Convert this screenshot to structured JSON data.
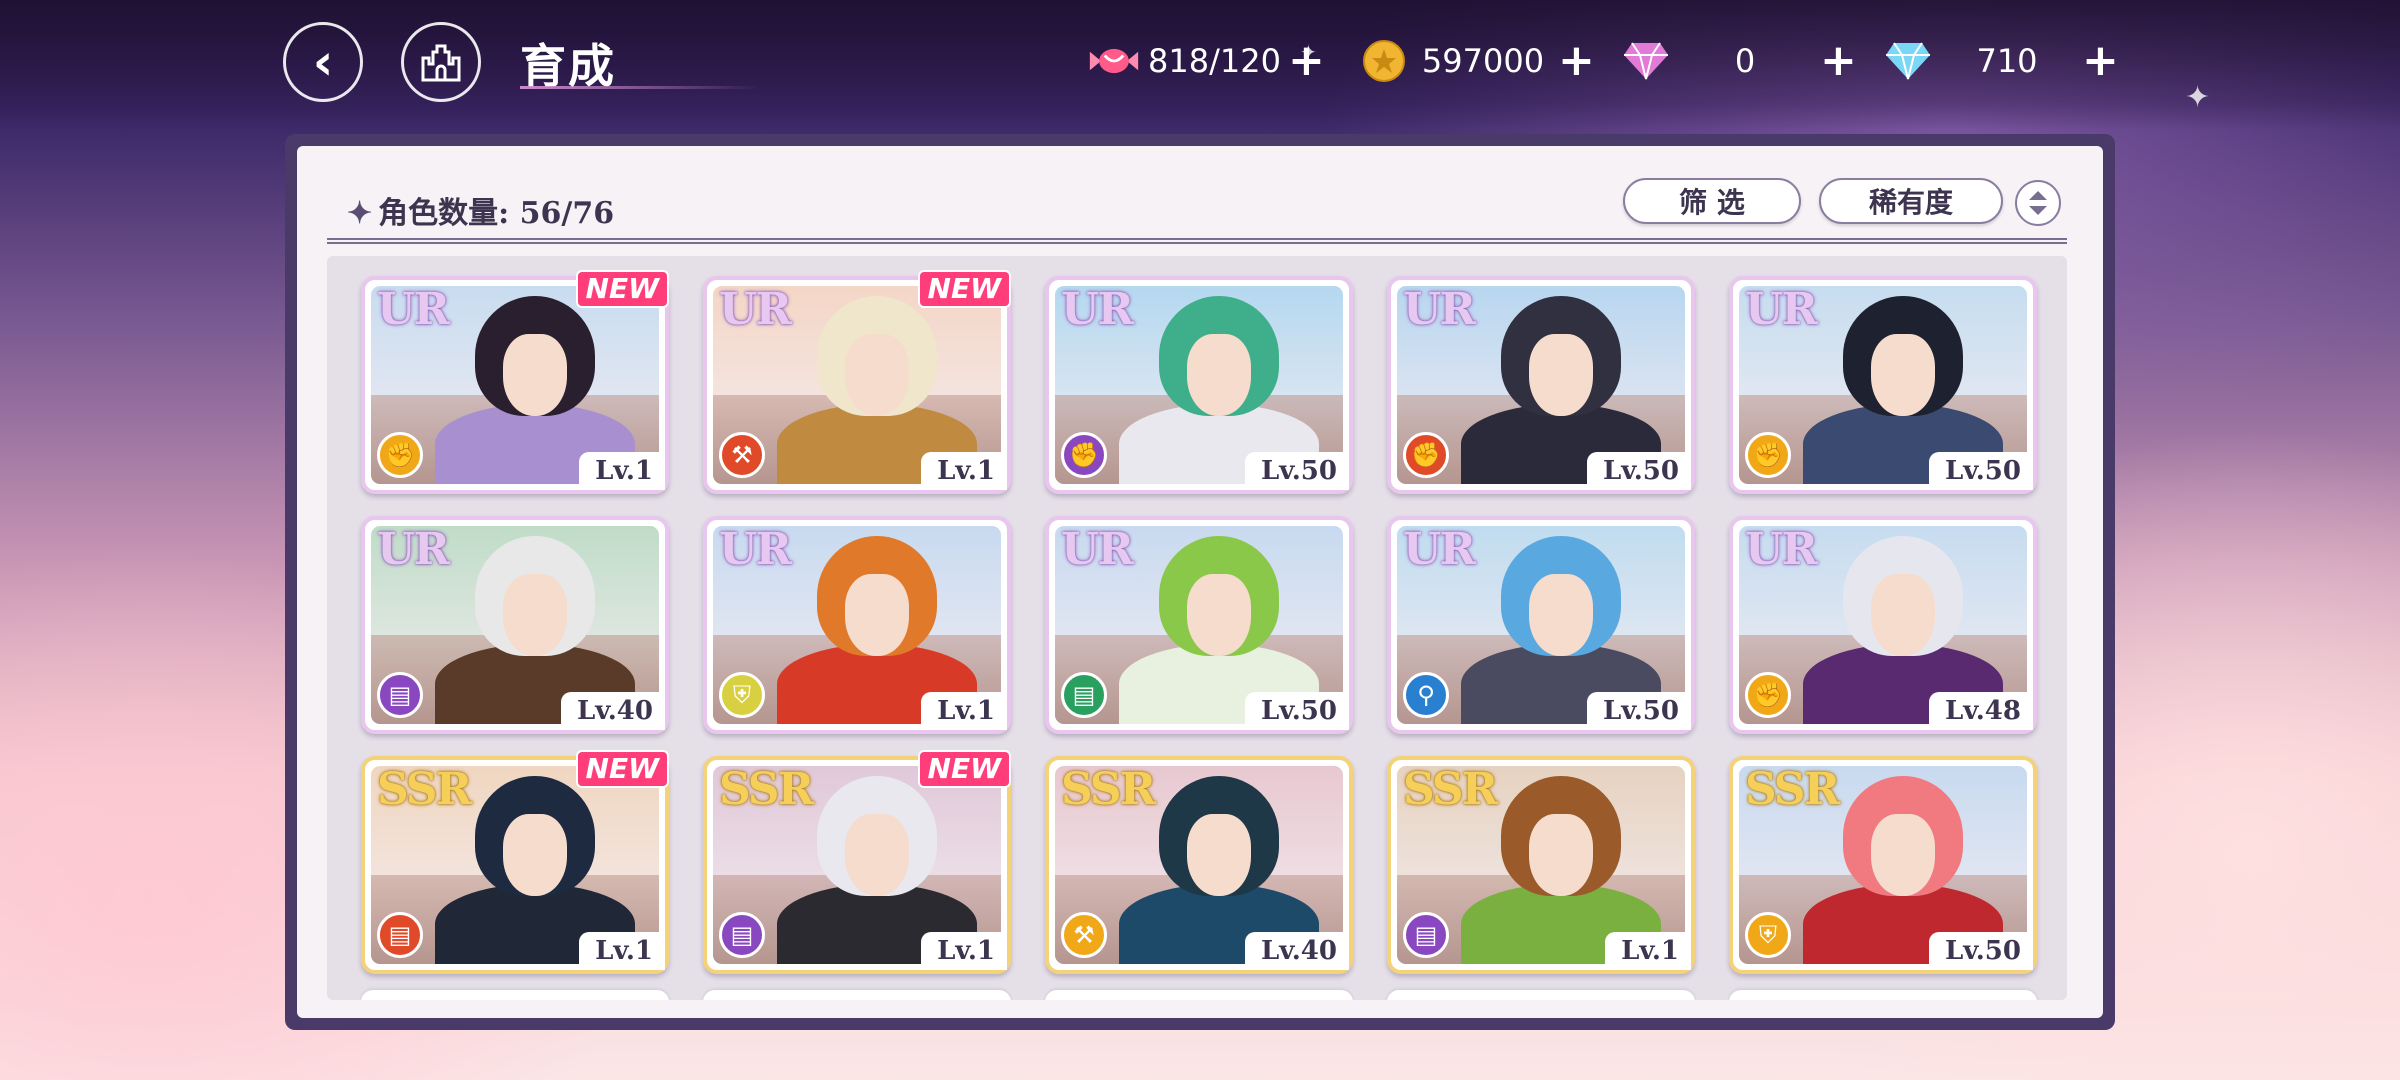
{
  "header": {
    "title": "育成",
    "resources": [
      {
        "name": "candy",
        "value": "818/120",
        "icon": "candy-icon",
        "color": "#ff6a9a"
      },
      {
        "name": "coin",
        "value": "597000",
        "icon": "coin-icon",
        "color": "#f2b531"
      },
      {
        "name": "pink-gem",
        "value": "0",
        "icon": "pink-diamond-icon",
        "color": "#e27ad8"
      },
      {
        "name": "blue-gem",
        "value": "710",
        "icon": "blue-diamond-icon",
        "color": "#7ad8f6"
      }
    ]
  },
  "panel": {
    "count_label": "角色数量:",
    "count_value": "56/76",
    "filter_label": "筛 选",
    "sort_label": "稀有度"
  },
  "cards": [
    {
      "rarity": "UR",
      "new": "NEW",
      "level": "Lv.1",
      "type": "fist",
      "type_color": "#f0a818",
      "hair": "#2a1f2e",
      "sky": "#c8dcf0",
      "outfit": "#a890d0"
    },
    {
      "rarity": "UR",
      "new": "NEW",
      "level": "Lv.1",
      "type": "hammer",
      "type_color": "#e04a28",
      "hair": "#efe6cc",
      "sky": "#f4d6c6",
      "outfit": "#c08a40"
    },
    {
      "rarity": "UR",
      "new": "",
      "level": "Lv.50",
      "type": "fist",
      "type_color": "#8a48c0",
      "hair": "#3fae8a",
      "sky": "#b4d8f0",
      "outfit": "#e8e8ee"
    },
    {
      "rarity": "UR",
      "new": "",
      "level": "Lv.50",
      "type": "fist",
      "type_color": "#e04a28",
      "hair": "#303040",
      "sky": "#b8d6f0",
      "outfit": "#2a2a3a"
    },
    {
      "rarity": "UR",
      "new": "",
      "level": "Lv.50",
      "type": "fist",
      "type_color": "#f0a818",
      "hair": "#1e2230",
      "sky": "#c6ddf0",
      "outfit": "#3a4a70"
    },
    {
      "rarity": "UR",
      "new": "",
      "level": "Lv.40",
      "type": "book",
      "type_color": "#8a48c0",
      "hair": "#e8e8e8",
      "sky": "#c0dcc8",
      "outfit": "#5a3a28"
    },
    {
      "rarity": "UR",
      "new": "",
      "level": "Lv.1",
      "type": "shield",
      "type_color": "#d8d040",
      "hair": "#e07a2a",
      "sky": "#c8daf0",
      "outfit": "#d83a28"
    },
    {
      "rarity": "UR",
      "new": "",
      "level": "Lv.50",
      "type": "book",
      "type_color": "#2aa060",
      "hair": "#8ac84a",
      "sky": "#c8daf0",
      "outfit": "#e8f0e0"
    },
    {
      "rarity": "UR",
      "new": "",
      "level": "Lv.50",
      "type": "wrench",
      "type_color": "#2a80d0",
      "hair": "#5aa8e0",
      "sky": "#c0dcf0",
      "outfit": "#4a4a60"
    },
    {
      "rarity": "UR",
      "new": "",
      "level": "Lv.48",
      "type": "fist",
      "type_color": "#f0a818",
      "hair": "#e6e6ee",
      "sky": "#c6dcf0",
      "outfit": "#5a2a70"
    },
    {
      "rarity": "SSR",
      "new": "NEW",
      "level": "Lv.1",
      "type": "book",
      "type_color": "#e04a28",
      "hair": "#1e2a40",
      "sky": "#f0d6c0",
      "outfit": "#202838"
    },
    {
      "rarity": "SSR",
      "new": "NEW",
      "level": "Lv.1",
      "type": "book",
      "type_color": "#8a48c0",
      "hair": "#e8e8ee",
      "sky": "#e0c8d8",
      "outfit": "#2a2a30"
    },
    {
      "rarity": "SSR",
      "new": "",
      "level": "Lv.40",
      "type": "hammer",
      "type_color": "#f0a818",
      "hair": "#1e3848",
      "sky": "#e8c8d0",
      "outfit": "#1e4a6a"
    },
    {
      "rarity": "SSR",
      "new": "",
      "level": "Lv.1",
      "type": "book",
      "type_color": "#8a48c0",
      "hair": "#9a5a2a",
      "sky": "#e6d2c0",
      "outfit": "#7ab040"
    },
    {
      "rarity": "SSR",
      "new": "",
      "level": "Lv.50",
      "type": "shield",
      "type_color": "#f0a818",
      "hair": "#f07a80",
      "sky": "#c8daf0",
      "outfit": "#c02830"
    }
  ]
}
